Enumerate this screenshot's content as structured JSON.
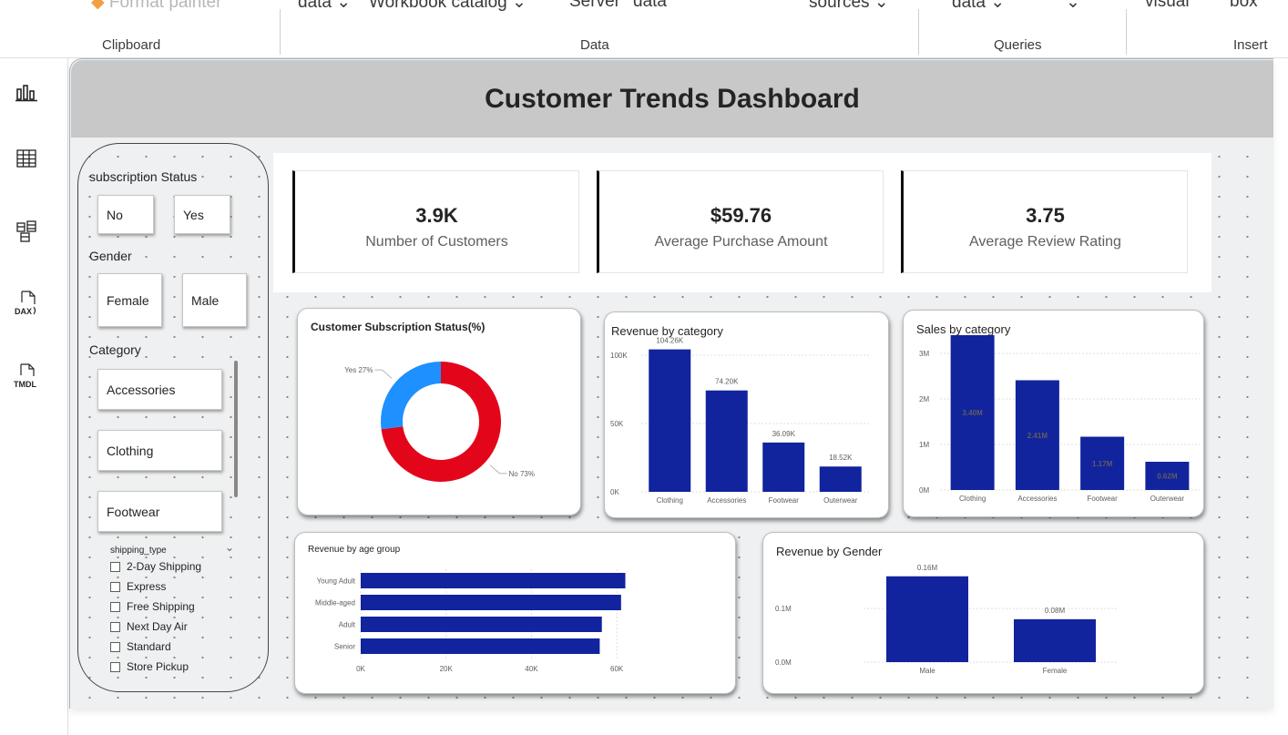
{
  "ribbon": {
    "top_items": [
      "Format painter",
      "data",
      "Workbook catalog",
      "Server",
      "data",
      "sources",
      "data",
      "visual",
      "box"
    ],
    "groups": [
      "Clipboard",
      "Data",
      "Queries",
      "Insert"
    ]
  },
  "rail": {
    "icons": [
      "report-view-icon",
      "table-view-icon",
      "model-view-icon",
      "dax-query-icon",
      "tmdl-view-icon"
    ],
    "dax_label": "DAX",
    "tmdl_label": "TMDL"
  },
  "dashboard": {
    "title": "Customer Trends Dashboard"
  },
  "slicers": {
    "subscription": {
      "label": "subscription Status",
      "options": [
        "No",
        "Yes"
      ]
    },
    "gender": {
      "label": "Gender",
      "options": [
        "Female",
        "Male"
      ]
    },
    "category": {
      "label": "Category",
      "options": [
        "Accessories",
        "Clothing",
        "Footwear"
      ]
    },
    "shipping": {
      "label": "shipping_type",
      "options": [
        "2-Day Shipping",
        "Express",
        "Free Shipping",
        "Next Day Air",
        "Standard",
        "Store Pickup"
      ]
    }
  },
  "kpis": [
    {
      "value": "3.9K",
      "label": "Number of Customers"
    },
    {
      "value": "$59.76",
      "label": "Average Purchase Amount"
    },
    {
      "value": "3.75",
      "label": "Average Review Rating"
    }
  ],
  "colors": {
    "bar": "#12239e",
    "donut_no": "#e3061b",
    "donut_yes": "#1e90ff",
    "title_bar": "#c8c8c8"
  },
  "chart_data": [
    {
      "type": "pie",
      "title": "Customer Subscription Status(%)",
      "categories": [
        "No",
        "Yes"
      ],
      "values": [
        73,
        27
      ],
      "labels": [
        "No 73%",
        "Yes 27%"
      ]
    },
    {
      "type": "bar",
      "title": "Revenue by category",
      "categories": [
        "Clothing",
        "Accessories",
        "Footwear",
        "Outerwear"
      ],
      "values": [
        104260,
        74200,
        36090,
        18520
      ],
      "data_labels": [
        "104.26K",
        "74.20K",
        "36.09K",
        "18.52K"
      ],
      "yticks": [
        "0K",
        "50K",
        "100K"
      ],
      "ylim": [
        0,
        110000
      ]
    },
    {
      "type": "bar",
      "title": "Sales by category",
      "categories": [
        "Clothing",
        "Accessories",
        "Footwear",
        "Outerwear"
      ],
      "values": [
        3400000,
        2410000,
        1170000,
        620000
      ],
      "data_labels": [
        "3.40M",
        "2.41M",
        "1.17M",
        "0.62M"
      ],
      "yticks": [
        "0M",
        "1M",
        "2M",
        "3M"
      ],
      "ylim": [
        0,
        3600000
      ]
    },
    {
      "type": "bar",
      "orientation": "horizontal",
      "title": "Revenue by age group",
      "categories": [
        "Young Adult",
        "Middle-aged",
        "Adult",
        "Senior"
      ],
      "values": [
        62000,
        61000,
        56500,
        56000
      ],
      "xticks": [
        "0K",
        "20K",
        "40K",
        "60K"
      ],
      "xlim": [
        0,
        70000
      ]
    },
    {
      "type": "bar",
      "title": "Revenue by Gender",
      "categories": [
        "Male",
        "Female"
      ],
      "values": [
        160000,
        80000
      ],
      "data_labels": [
        "0.16M",
        "0.08M"
      ],
      "yticks": [
        "0.0M",
        "0.1M"
      ],
      "ylim": [
        0,
        180000
      ]
    }
  ]
}
